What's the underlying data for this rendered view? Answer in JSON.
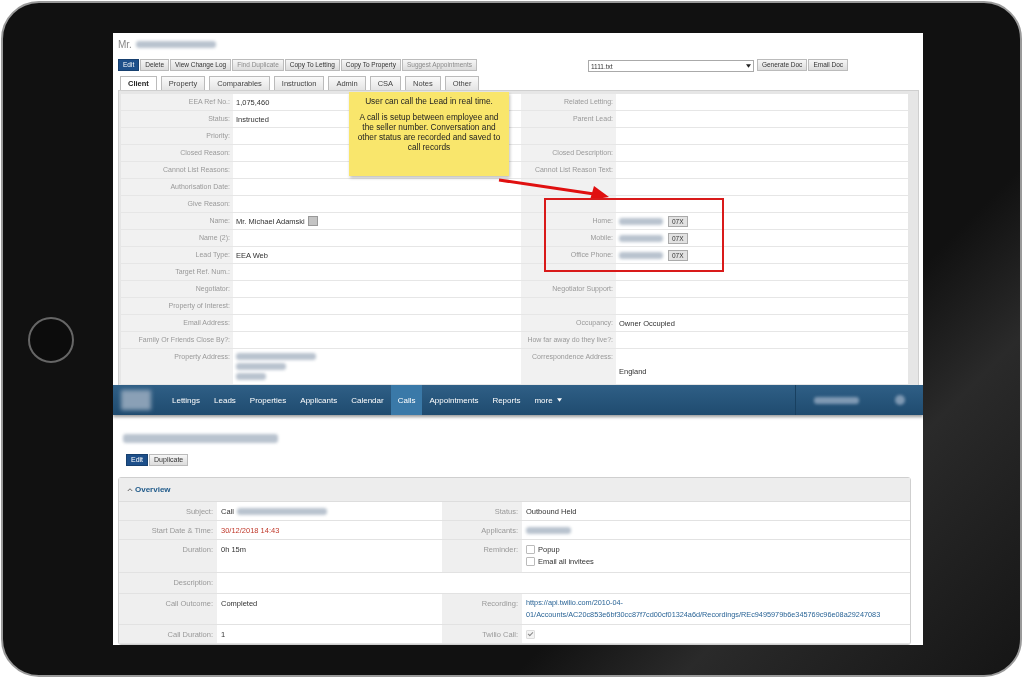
{
  "record": {
    "title": "Mr.",
    "toolbar": [
      {
        "label": "Edit",
        "selected": true,
        "disabled": false
      },
      {
        "label": "Delete",
        "selected": false,
        "disabled": false
      },
      {
        "label": "View Change Log",
        "selected": false,
        "disabled": false
      },
      {
        "label": "Find Duplicate",
        "selected": false,
        "disabled": true
      },
      {
        "label": "Copy To Letting",
        "selected": false,
        "disabled": false
      },
      {
        "label": "Copy To Property",
        "selected": false,
        "disabled": false
      },
      {
        "label": "Suggest Appointments",
        "selected": false,
        "disabled": true
      }
    ],
    "document_select": {
      "value": "1111.txt"
    },
    "doc_buttons": [
      "Generate Doc",
      "Email Doc"
    ],
    "tabs": [
      {
        "label": "Client",
        "selected": true
      },
      {
        "label": "Property",
        "selected": false
      },
      {
        "label": "Comparables",
        "selected": false
      },
      {
        "label": "Instruction",
        "selected": false
      },
      {
        "label": "Admin",
        "selected": false
      },
      {
        "label": "CSA",
        "selected": false
      },
      {
        "label": "Notes",
        "selected": false
      },
      {
        "label": "Other",
        "selected": false
      }
    ],
    "rows": [
      {
        "left": {
          "label": "EEA Ref No.:",
          "value": "1,075,460",
          "kind": "text"
        },
        "right": {
          "label": "Related Letting:",
          "kind": "text"
        }
      },
      {
        "left": {
          "label": "Status:",
          "value": "Instructed",
          "kind": "text"
        },
        "right": {
          "label": "Parent Lead:",
          "kind": "text"
        }
      },
      {
        "left": {
          "label": "Priority:",
          "kind": "text"
        }
      },
      {
        "left": {
          "label": "Closed Reason:",
          "kind": "text"
        },
        "right": {
          "label": "Closed Description:",
          "kind": "text"
        }
      },
      {
        "left": {
          "label": "Cannot List Reasons:",
          "kind": "text"
        },
        "right": {
          "label": "Cannot List Reason Text:",
          "kind": "text"
        }
      },
      {
        "left": {
          "label": "Authorisation Date:",
          "kind": "text"
        }
      },
      {
        "left": {
          "label": "Give Reason:",
          "kind": "text"
        }
      },
      {
        "left": {
          "label": "Name:",
          "value": "Mr. Michael Adamski",
          "kind": "name"
        },
        "right": {
          "label": "Home:",
          "kind": "phone",
          "button": "07X"
        }
      },
      {
        "left": {
          "label": "Name (2):",
          "kind": "text"
        },
        "right": {
          "label": "Mobile:",
          "kind": "phone",
          "button": "07X"
        }
      },
      {
        "left": {
          "label": "Lead Type:",
          "value": "EEA Web",
          "kind": "text"
        },
        "right": {
          "label": "Office Phone:",
          "kind": "phone",
          "button": "07X"
        }
      },
      {
        "left": {
          "label": "Target Ref. Num.:",
          "kind": "text"
        }
      },
      {
        "left": {
          "label": "Negotiator:",
          "kind": "text"
        },
        "right": {
          "label": "Negotiator Support:",
          "kind": "text"
        }
      },
      {
        "left": {
          "label": "Property of Interest:",
          "kind": "text"
        }
      },
      {
        "left": {
          "label": "Email Address:",
          "kind": "text"
        },
        "right": {
          "label": "Occupancy:",
          "value": "Owner Occupied",
          "kind": "text"
        }
      },
      {
        "left": {
          "label": "Family Or Friends Close By?:",
          "kind": "text"
        },
        "right": {
          "label": "How far away do they live?:",
          "kind": "text"
        }
      },
      {
        "left": {
          "label": "Property Address:",
          "kind": "blurred_address"
        },
        "right": {
          "label": "Correspondence Address:",
          "value": "England",
          "kind": "address"
        }
      }
    ]
  },
  "annotation": {
    "lines": [
      "User can call the Lead in real time.",
      "A call is setup between employee and the seller number. Conversation and other status are recorded and saved to call records"
    ]
  },
  "nav": {
    "items": [
      {
        "label": "Lettings",
        "selected": false
      },
      {
        "label": "Leads",
        "selected": false
      },
      {
        "label": "Properties",
        "selected": false
      },
      {
        "label": "Applicants",
        "selected": false
      },
      {
        "label": "Calendar",
        "selected": false
      },
      {
        "label": "Calls",
        "selected": true
      },
      {
        "label": "Appointments",
        "selected": false
      },
      {
        "label": "Reports",
        "selected": false
      }
    ],
    "more": "more"
  },
  "call": {
    "buttons": [
      {
        "label": "Edit",
        "selected": true
      },
      {
        "label": "Duplicate",
        "selected": false
      }
    ],
    "section": {
      "title": "Overview",
      "expanded": true
    },
    "rows": [
      {
        "kind": "pair",
        "left": {
          "label": "Subject:",
          "value": "Call",
          "kind": "text_blur"
        },
        "right": {
          "label": "Status:",
          "value": "Outbound Held",
          "kind": "text"
        }
      },
      {
        "kind": "pair",
        "left": {
          "label": "Start Date & Time:",
          "value": "30/12/2018 14:43",
          "kind": "warning"
        },
        "right": {
          "label": "Applicants:",
          "kind": "blurred"
        }
      },
      {
        "kind": "pair",
        "left": {
          "label": "Duration:",
          "value": "0h 15m",
          "kind": "text"
        },
        "right": {
          "label": "Reminder:",
          "kind": "checks",
          "options": [
            {
              "label": "Popup",
              "checked": false
            },
            {
              "label": "Email all invitees",
              "checked": false
            }
          ]
        }
      },
      {
        "kind": "wide",
        "left": {
          "label": "Description:",
          "kind": "text"
        }
      },
      {
        "kind": "pair",
        "left": {
          "label": "Call Outcome:",
          "value": "Completed",
          "kind": "text"
        },
        "right": {
          "label": "Recording:",
          "value": "https://api.twilio.com/2010-04-01/Accounts/AC20c853e6bf30cc87f7cd00cf01324a6d/Recordings/REc9495979b6e345769c96e08a29247083",
          "kind": "link"
        }
      },
      {
        "kind": "pair",
        "left": {
          "label": "Call Duration:",
          "value": "1",
          "kind": "text"
        },
        "right": {
          "label": "Twilio Call:",
          "kind": "check",
          "checked": true,
          "disabled": true
        }
      }
    ]
  }
}
